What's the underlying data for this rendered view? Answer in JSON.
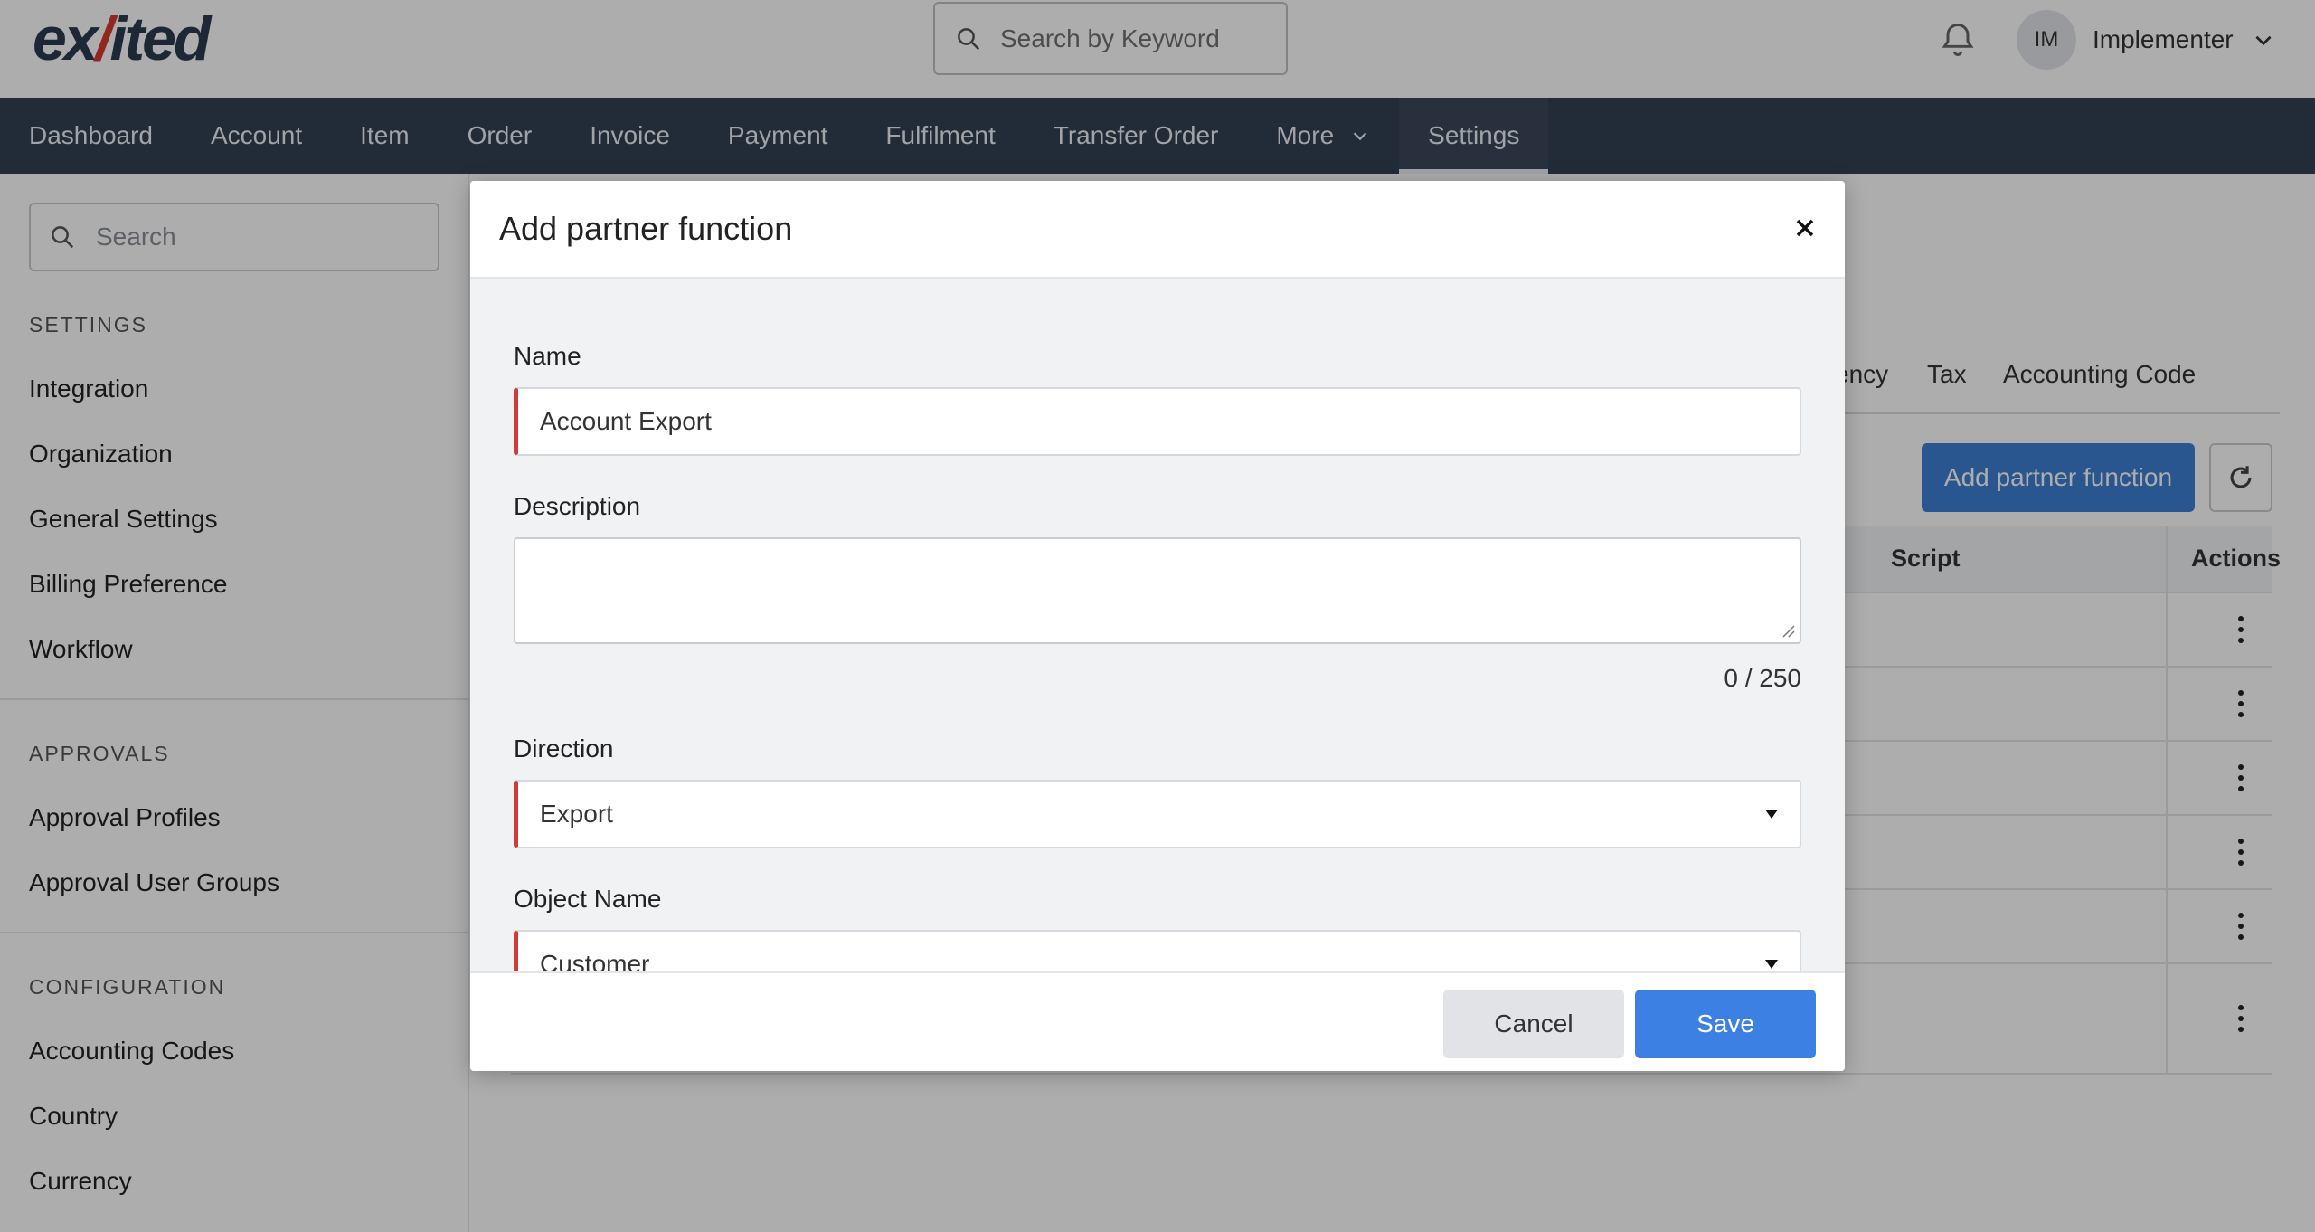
{
  "header": {
    "logo_main": "ex",
    "logo_mark": "/",
    "logo_tail": "ited",
    "search_placeholder": "Search by Keyword",
    "user_initials": "IM",
    "user_name": "Implementer"
  },
  "nav": {
    "items": [
      "Dashboard",
      "Account",
      "Item",
      "Order",
      "Invoice",
      "Payment",
      "Fulfilment",
      "Transfer Order",
      "More",
      "Settings"
    ],
    "active": "Settings"
  },
  "sidebar": {
    "search_placeholder": "Search",
    "sections": [
      {
        "title": "SETTINGS",
        "items": [
          "Integration",
          "Organization",
          "General Settings",
          "Billing Preference",
          "Workflow"
        ]
      },
      {
        "title": "APPROVALS",
        "items": [
          "Approval Profiles",
          "Approval User Groups"
        ]
      },
      {
        "title": "CONFIGURATION",
        "items": [
          "Accounting Codes",
          "Country",
          "Currency"
        ]
      }
    ]
  },
  "main": {
    "tabs_visible": [
      "ency",
      "Tax",
      "Accounting Code"
    ],
    "add_button_label": "Add partner function",
    "table": {
      "headers": [
        "Script",
        "Actions"
      ],
      "row_count": 6
    }
  },
  "modal": {
    "title": "Add partner function",
    "fields": {
      "name_label": "Name",
      "name_value": "Account Export",
      "description_label": "Description",
      "description_value": "",
      "description_counter": "0 / 250",
      "direction_label": "Direction",
      "direction_value": "Export",
      "object_name_label": "Object Name",
      "object_name_value": "Customer"
    },
    "cancel_label": "Cancel",
    "save_label": "Save"
  },
  "colors": {
    "nav_bg": "#334155",
    "primary": "#3d80e3",
    "required_marker": "#d33b3b"
  }
}
